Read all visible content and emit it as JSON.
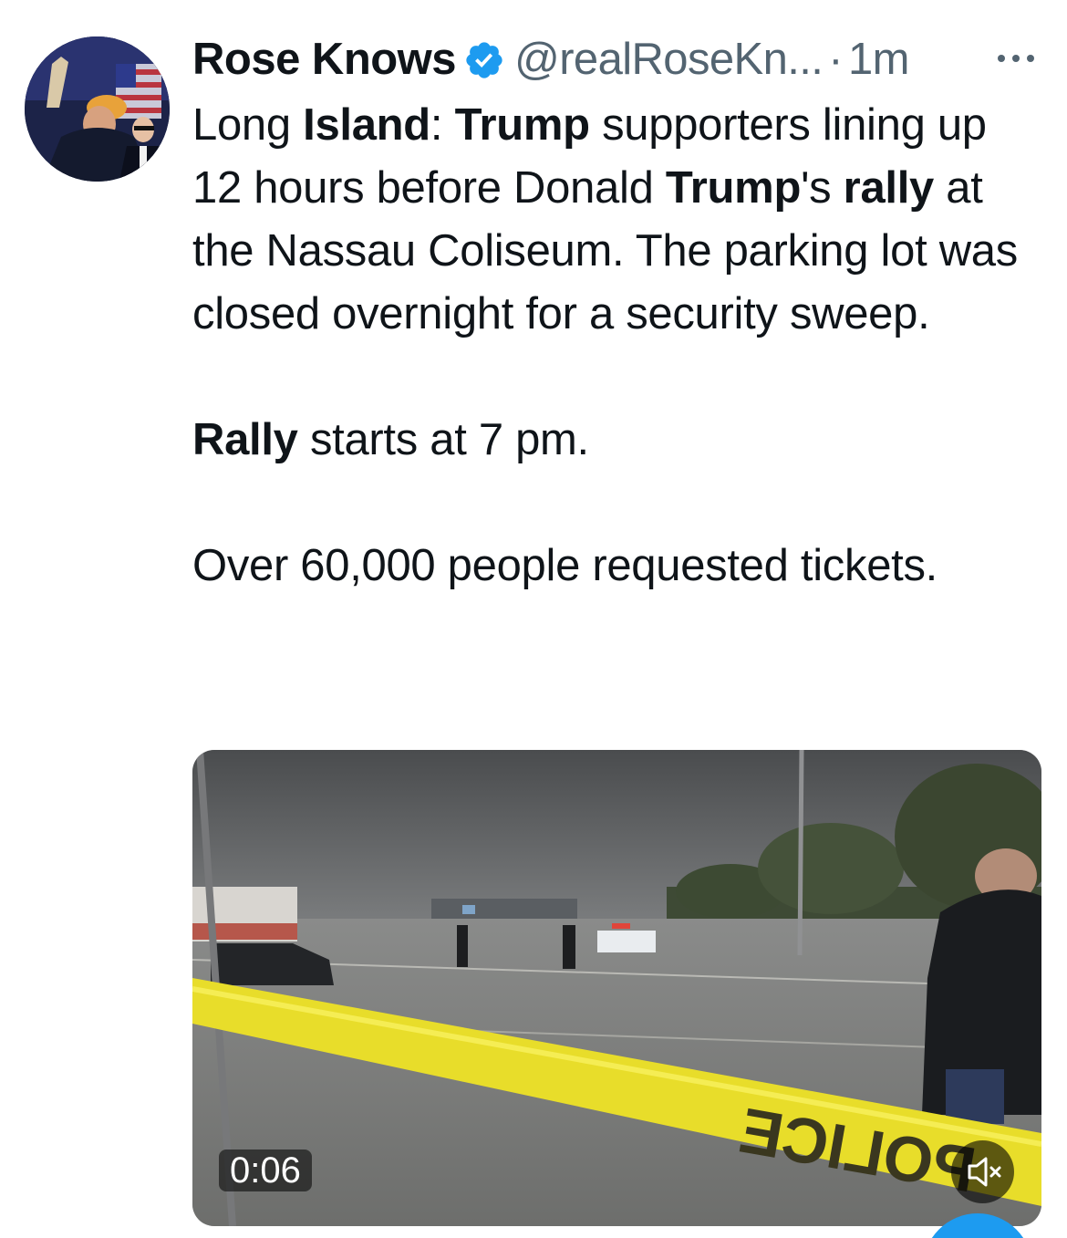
{
  "author": {
    "display_name": "Rose Knows",
    "handle": "@realRoseKn...",
    "separator": "·",
    "time_ago": "1m",
    "verified": true
  },
  "tweet": {
    "segments_p1": [
      {
        "text": "Long ",
        "bold": false
      },
      {
        "text": "Island",
        "bold": true
      },
      {
        "text": ": ",
        "bold": false
      },
      {
        "text": "Trump",
        "bold": true
      },
      {
        "text": " supporters lining up 12 hours before Donald ",
        "bold": false
      },
      {
        "text": "Trump",
        "bold": true
      },
      {
        "text": "'s ",
        "bold": false
      },
      {
        "text": "rally",
        "bold": true
      },
      {
        "text": " at the Nassau Coliseum. The parking lot was closed overnight for a security sweep.",
        "bold": false
      }
    ],
    "segments_p2": [
      {
        "text": "Rally",
        "bold": true
      },
      {
        "text": " starts at 7 pm.",
        "bold": false
      }
    ],
    "segments_p3": [
      {
        "text": "Over 60,000 people requested tickets.",
        "bold": false
      }
    ]
  },
  "media": {
    "type": "video",
    "duration_label": "0:06",
    "muted": true,
    "tape_text": "POLICE"
  },
  "icons": {
    "verified": "verified-badge-icon",
    "more": "more-options-icon",
    "mute": "volume-muted-icon"
  },
  "colors": {
    "accent": "#1d9bf0",
    "text_primary": "#0f1419",
    "text_secondary": "#536471"
  }
}
